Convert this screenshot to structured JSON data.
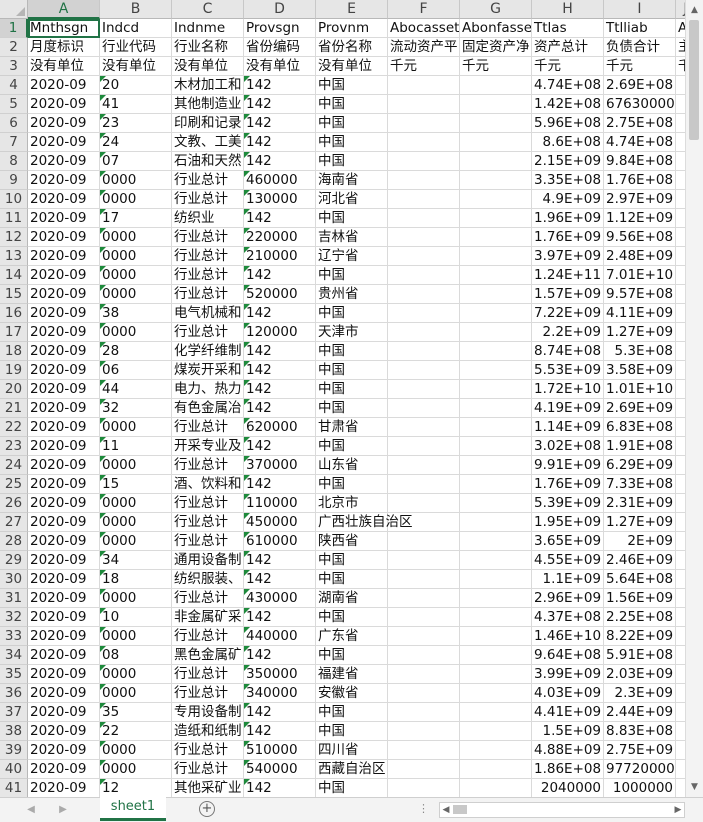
{
  "sheet": {
    "columns": [
      "A",
      "B",
      "C",
      "D",
      "E",
      "F",
      "G",
      "H",
      "I"
    ],
    "partial_col_label": "J",
    "active_cell": "A1",
    "rows": [
      {
        "n": "1",
        "A": "Mnthsgn",
        "B": "Indcd",
        "C": "Indnme",
        "D": "Provsgn",
        "E": "Provnm",
        "F": "Abocasset",
        "G": "Abonfasset",
        "H": "Ttlas",
        "I": "Ttlliab",
        "J": "A"
      },
      {
        "n": "2",
        "A": "月度标识",
        "B": "行业代码",
        "C": "行业名称",
        "D": "省份编码",
        "E": "省份名称",
        "F": "流动资产平",
        "G": "固定资产净",
        "H": "资产总计",
        "I": "负债合计",
        "J": "主"
      },
      {
        "n": "3",
        "A": "没有单位",
        "B": "没有单位",
        "C": "没有单位",
        "D": "没有单位",
        "E": "没有单位",
        "F": "千元",
        "G": "千元",
        "H": "千元",
        "I": "千元",
        "J": "千"
      },
      {
        "n": "4",
        "A": "2020-09",
        "B": "20",
        "C": "木材加工和",
        "D": "142",
        "E": "中国",
        "H": "4.74E+08",
        "I": "2.69E+08"
      },
      {
        "n": "5",
        "A": "2020-09",
        "B": "41",
        "C": "其他制造业",
        "D": "142",
        "E": "中国",
        "H": "1.42E+08",
        "I": "67630000"
      },
      {
        "n": "6",
        "A": "2020-09",
        "B": "23",
        "C": "印刷和记录",
        "D": "142",
        "E": "中国",
        "H": "5.96E+08",
        "I": "2.75E+08"
      },
      {
        "n": "7",
        "A": "2020-09",
        "B": "24",
        "C": "文教、工美",
        "D": "142",
        "E": "中国",
        "H": "8.6E+08",
        "I": "4.74E+08"
      },
      {
        "n": "8",
        "A": "2020-09",
        "B": "07",
        "C": "石油和天然",
        "D": "142",
        "E": "中国",
        "H": "2.15E+09",
        "I": "9.84E+08"
      },
      {
        "n": "9",
        "A": "2020-09",
        "B": "0000",
        "C": "行业总计",
        "D": "460000",
        "E": "海南省",
        "H": "3.35E+08",
        "I": "1.76E+08"
      },
      {
        "n": "10",
        "A": "2020-09",
        "B": "0000",
        "C": "行业总计",
        "D": "130000",
        "E": "河北省",
        "H": "4.9E+09",
        "I": "2.97E+09"
      },
      {
        "n": "11",
        "A": "2020-09",
        "B": "17",
        "C": "纺织业",
        "D": "142",
        "E": "中国",
        "H": "1.96E+09",
        "I": "1.12E+09"
      },
      {
        "n": "12",
        "A": "2020-09",
        "B": "0000",
        "C": "行业总计",
        "D": "220000",
        "E": "吉林省",
        "H": "1.76E+09",
        "I": "9.56E+08"
      },
      {
        "n": "13",
        "A": "2020-09",
        "B": "0000",
        "C": "行业总计",
        "D": "210000",
        "E": "辽宁省",
        "H": "3.97E+09",
        "I": "2.48E+09"
      },
      {
        "n": "14",
        "A": "2020-09",
        "B": "0000",
        "C": "行业总计",
        "D": "142",
        "E": "中国",
        "H": "1.24E+11",
        "I": "7.01E+10"
      },
      {
        "n": "15",
        "A": "2020-09",
        "B": "0000",
        "C": "行业总计",
        "D": "520000",
        "E": "贵州省",
        "H": "1.57E+09",
        "I": "9.57E+08"
      },
      {
        "n": "16",
        "A": "2020-09",
        "B": "38",
        "C": "电气机械和",
        "D": "142",
        "E": "中国",
        "H": "7.22E+09",
        "I": "4.11E+09"
      },
      {
        "n": "17",
        "A": "2020-09",
        "B": "0000",
        "C": "行业总计",
        "D": "120000",
        "E": "天津市",
        "H": "2.2E+09",
        "I": "1.27E+09"
      },
      {
        "n": "18",
        "A": "2020-09",
        "B": "28",
        "C": "化学纤维制",
        "D": "142",
        "E": "中国",
        "H": "8.74E+08",
        "I": "5.3E+08"
      },
      {
        "n": "19",
        "A": "2020-09",
        "B": "06",
        "C": "煤炭开采和",
        "D": "142",
        "E": "中国",
        "H": "5.53E+09",
        "I": "3.58E+09"
      },
      {
        "n": "20",
        "A": "2020-09",
        "B": "44",
        "C": "电力、热力",
        "D": "142",
        "E": "中国",
        "H": "1.72E+10",
        "I": "1.01E+10"
      },
      {
        "n": "21",
        "A": "2020-09",
        "B": "32",
        "C": "有色金属冶",
        "D": "142",
        "E": "中国",
        "H": "4.19E+09",
        "I": "2.69E+09"
      },
      {
        "n": "22",
        "A": "2020-09",
        "B": "0000",
        "C": "行业总计",
        "D": "620000",
        "E": "甘肃省",
        "H": "1.14E+09",
        "I": "6.83E+08"
      },
      {
        "n": "23",
        "A": "2020-09",
        "B": "11",
        "C": "开采专业及",
        "D": "142",
        "E": "中国",
        "H": "3.02E+08",
        "I": "1.91E+08"
      },
      {
        "n": "24",
        "A": "2020-09",
        "B": "0000",
        "C": "行业总计",
        "D": "370000",
        "E": "山东省",
        "H": "9.91E+09",
        "I": "6.29E+09"
      },
      {
        "n": "25",
        "A": "2020-09",
        "B": "15",
        "C": "酒、饮料和",
        "D": "142",
        "E": "中国",
        "H": "1.76E+09",
        "I": "7.33E+08"
      },
      {
        "n": "26",
        "A": "2020-09",
        "B": "0000",
        "C": "行业总计",
        "D": "110000",
        "E": "北京市",
        "H": "5.39E+09",
        "I": "2.31E+09"
      },
      {
        "n": "27",
        "A": "2020-09",
        "B": "0000",
        "C": "行业总计",
        "D": "450000",
        "E": "广西壮族自治区",
        "H": "1.95E+09",
        "I": "1.27E+09"
      },
      {
        "n": "28",
        "A": "2020-09",
        "B": "0000",
        "C": "行业总计",
        "D": "610000",
        "E": "陕西省",
        "H": "3.65E+09",
        "I": "2E+09"
      },
      {
        "n": "29",
        "A": "2020-09",
        "B": "34",
        "C": "通用设备制",
        "D": "142",
        "E": "中国",
        "H": "4.55E+09",
        "I": "2.46E+09"
      },
      {
        "n": "30",
        "A": "2020-09",
        "B": "18",
        "C": "纺织服装、",
        "D": "142",
        "E": "中国",
        "H": "1.1E+09",
        "I": "5.64E+08"
      },
      {
        "n": "31",
        "A": "2020-09",
        "B": "0000",
        "C": "行业总计",
        "D": "430000",
        "E": "湖南省",
        "H": "2.96E+09",
        "I": "1.56E+09"
      },
      {
        "n": "32",
        "A": "2020-09",
        "B": "10",
        "C": "非金属矿采",
        "D": "142",
        "E": "中国",
        "H": "4.37E+08",
        "I": "2.25E+08"
      },
      {
        "n": "33",
        "A": "2020-09",
        "B": "0000",
        "C": "行业总计",
        "D": "440000",
        "E": "广东省",
        "H": "1.46E+10",
        "I": "8.22E+09"
      },
      {
        "n": "34",
        "A": "2020-09",
        "B": "08",
        "C": "黑色金属矿",
        "D": "142",
        "E": "中国",
        "H": "9.64E+08",
        "I": "5.91E+08"
      },
      {
        "n": "35",
        "A": "2020-09",
        "B": "0000",
        "C": "行业总计",
        "D": "350000",
        "E": "福建省",
        "H": "3.99E+09",
        "I": "2.03E+09"
      },
      {
        "n": "36",
        "A": "2020-09",
        "B": "0000",
        "C": "行业总计",
        "D": "340000",
        "E": "安徽省",
        "H": "4.03E+09",
        "I": "2.3E+09"
      },
      {
        "n": "37",
        "A": "2020-09",
        "B": "35",
        "C": "专用设备制",
        "D": "142",
        "E": "中国",
        "H": "4.41E+09",
        "I": "2.44E+09"
      },
      {
        "n": "38",
        "A": "2020-09",
        "B": "22",
        "C": "造纸和纸制",
        "D": "142",
        "E": "中国",
        "H": "1.5E+09",
        "I": "8.83E+08"
      },
      {
        "n": "39",
        "A": "2020-09",
        "B": "0000",
        "C": "行业总计",
        "D": "510000",
        "E": "四川省",
        "H": "4.88E+09",
        "I": "2.75E+09"
      },
      {
        "n": "40",
        "A": "2020-09",
        "B": "0000",
        "C": "行业总计",
        "D": "540000",
        "E": "西藏自治区",
        "H": "1.86E+08",
        "I": "97720000"
      },
      {
        "n": "41",
        "A": "2020-09",
        "B": "12",
        "C": "其他采矿业",
        "D": "142",
        "E": "中国",
        "H": "2040000",
        "I": "1000000"
      }
    ]
  },
  "tabs": [
    {
      "label": "sheet1",
      "active": true
    }
  ],
  "add_sheet_label": "+",
  "overflow_dots": "⋮",
  "colors": {
    "accent": "#217346",
    "grid": "#dadada",
    "header_bg": "#e6e6e6",
    "text_marker": "#1e8a3c"
  }
}
